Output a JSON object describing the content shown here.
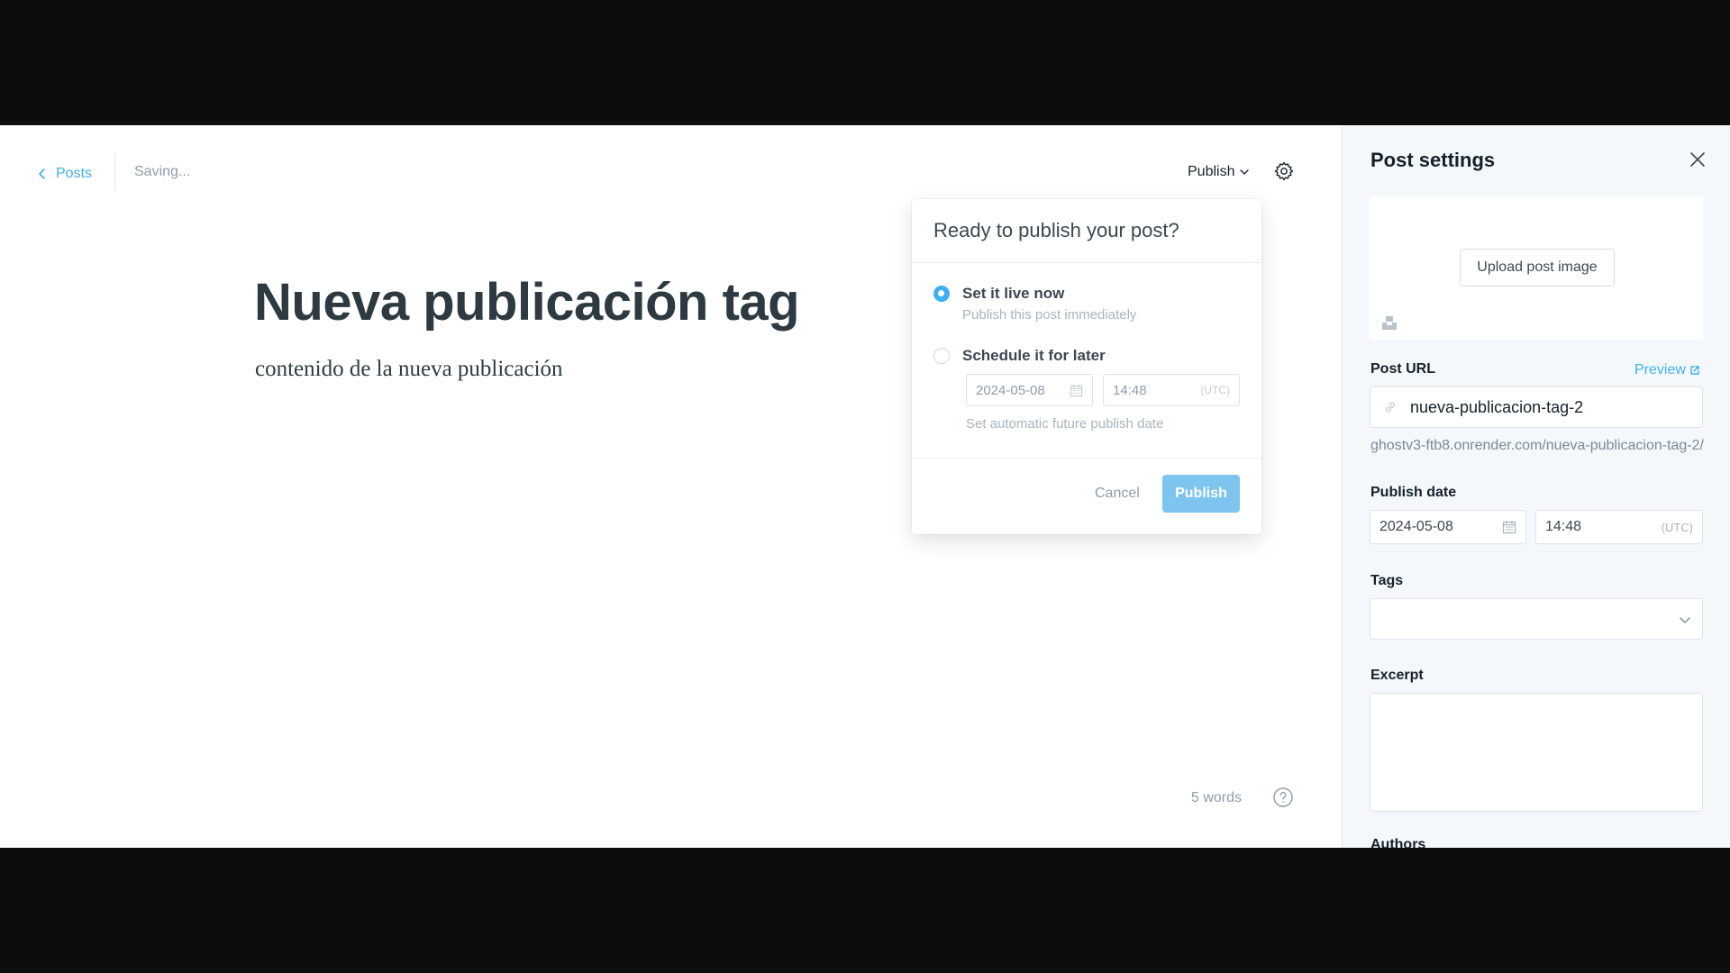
{
  "header": {
    "back_label": "Posts",
    "status": "Saving...",
    "publish_label": "Publish"
  },
  "post": {
    "title": "Nueva publicación tag",
    "body": "contenido de la nueva publicación",
    "word_count": "5 words"
  },
  "publish_menu": {
    "title": "Ready to publish your post?",
    "option_now": {
      "title": "Set it live now",
      "desc": "Publish this post immediately",
      "selected": true
    },
    "option_schedule": {
      "title": "Schedule it for later",
      "date": "2024-05-08",
      "time": "14:48",
      "timezone": "(UTC)",
      "desc": "Set automatic future publish date",
      "selected": false
    },
    "cancel_label": "Cancel",
    "publish_label": "Publish"
  },
  "sidebar": {
    "title": "Post settings",
    "upload_label": "Upload post image",
    "post_url_label": "Post URL",
    "preview_label": "Preview",
    "slug": "nueva-publicacion-tag-2",
    "full_url": "ghostv3-ftb8.onrender.com/nueva-publicacion-tag-2/",
    "publish_date_label": "Publish date",
    "publish_date": "2024-05-08",
    "publish_time": "14:48",
    "timezone": "(UTC)",
    "tags_label": "Tags",
    "excerpt_label": "Excerpt",
    "authors_label": "Authors"
  },
  "colors": {
    "accent": "#3eb0ef",
    "publish_button": "#7dc4ef",
    "sidebar_bg": "#f4f8fb",
    "letterbox": "#0d0d0d"
  },
  "icons": [
    "chevron-left-icon",
    "chevron-down-icon",
    "gear-icon",
    "help-icon",
    "close-icon",
    "calendar-icon",
    "link-icon",
    "external-link-icon",
    "unsplash-icon"
  ]
}
